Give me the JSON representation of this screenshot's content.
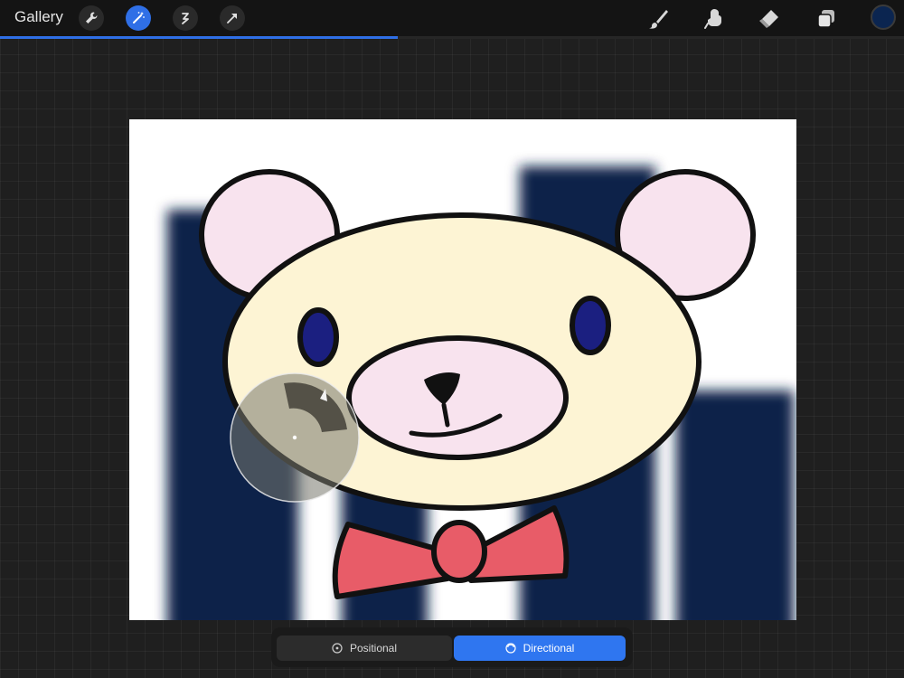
{
  "toolbar": {
    "gallery_label": "Gallery",
    "left_tools": [
      "wrench-icon",
      "magic-wand-icon",
      "selection-icon",
      "transform-arrow-icon"
    ],
    "right_tools": [
      "brush-icon",
      "smudge-icon",
      "eraser-icon",
      "layers-icon"
    ],
    "current_color": "#0b2550",
    "active_tool": "magic-wand-icon",
    "progress_percent": 44
  },
  "blur_mode": {
    "options": [
      "Positional",
      "Directional"
    ],
    "selected": "Directional",
    "positional_label": "Positional",
    "directional_label": "Directional"
  },
  "colors": {
    "accent": "#2f6fe6",
    "bear_face": "#fdf4d4",
    "bear_ear": "#f8e3ee",
    "bear_eye": "#1b1f80",
    "bow": "#e85c68",
    "background_bars": "#072448"
  }
}
